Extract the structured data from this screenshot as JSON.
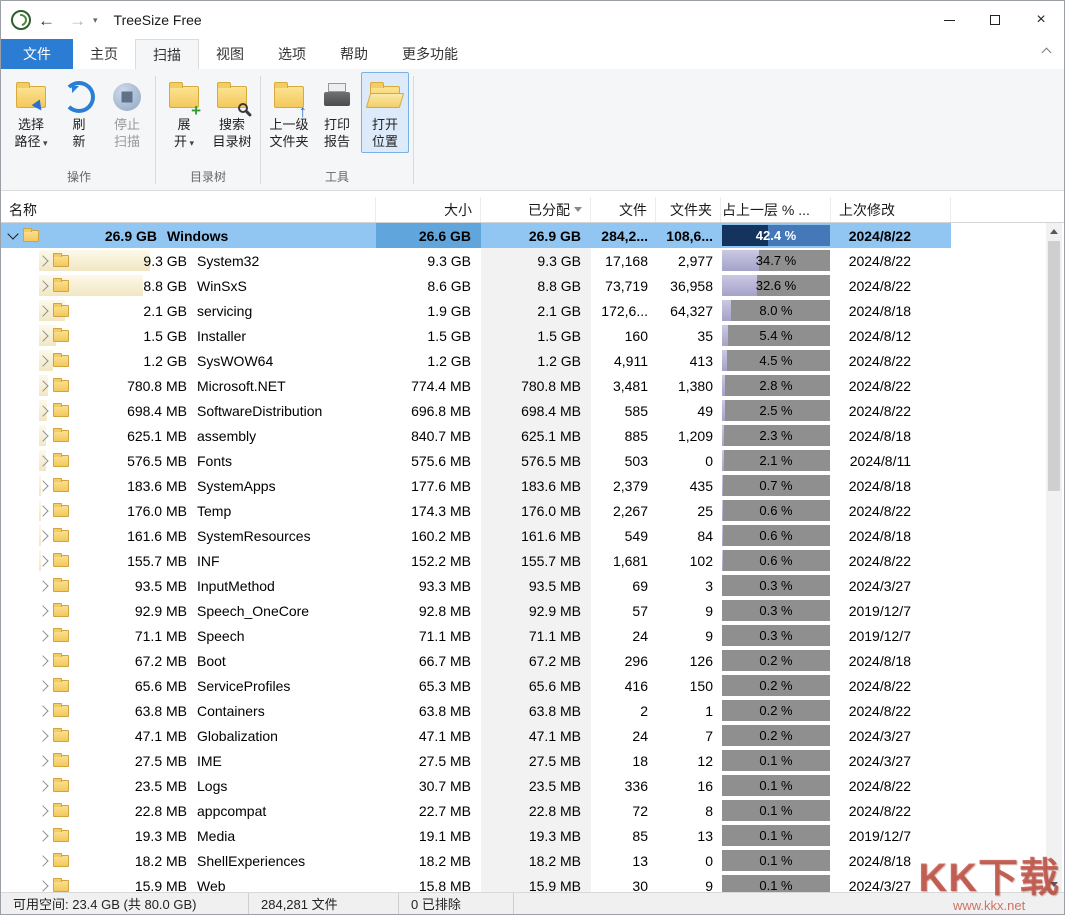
{
  "window": {
    "title": "TreeSize Free",
    "controls": {
      "close": "×"
    }
  },
  "nav": {
    "back": "←",
    "forward": "→"
  },
  "ribbon": {
    "tabs": [
      {
        "id": "file",
        "label": "文件",
        "type": "file"
      },
      {
        "id": "home",
        "label": "主页"
      },
      {
        "id": "scan",
        "label": "扫描",
        "active": true
      },
      {
        "id": "view",
        "label": "视图"
      },
      {
        "id": "options",
        "label": "选项"
      },
      {
        "id": "help",
        "label": "帮助"
      },
      {
        "id": "more-features",
        "label": "更多功能"
      }
    ],
    "groups": [
      {
        "label": "操作",
        "buttons": [
          {
            "id": "select-path",
            "lines": [
              "选择",
              "路径"
            ],
            "dropdown": true,
            "icon": "folder-cursor"
          },
          {
            "id": "refresh",
            "lines": [
              "刷",
              "新"
            ],
            "icon": "refresh"
          },
          {
            "id": "stop-scan",
            "lines": [
              "停止",
              "扫描"
            ],
            "icon": "stop",
            "disabled": true
          }
        ]
      },
      {
        "label": "目录树",
        "buttons": [
          {
            "id": "expand",
            "lines": [
              "展",
              "开"
            ],
            "dropdown": true,
            "icon": "folder-plus"
          },
          {
            "id": "search-tree",
            "lines": [
              "搜索",
              "目录树"
            ],
            "icon": "folder-search"
          }
        ]
      },
      {
        "label": "工具",
        "buttons": [
          {
            "id": "parent-folder",
            "lines": [
              "上一级",
              "文件夹"
            ],
            "icon": "folder-up"
          },
          {
            "id": "print-report",
            "lines": [
              "打印",
              "报告"
            ],
            "icon": "printer"
          },
          {
            "id": "open-location",
            "lines": [
              "打开",
              "位置"
            ],
            "icon": "folder-open",
            "highlighted": true
          }
        ]
      }
    ]
  },
  "table": {
    "columns": [
      {
        "label": "名称"
      },
      {
        "label": "大小"
      },
      {
        "label": "已分配",
        "sort": "desc"
      },
      {
        "label": "文件"
      },
      {
        "label": "文件夹"
      },
      {
        "label": "占上一层 % ..."
      },
      {
        "label": "上次修改"
      }
    ],
    "rows": [
      {
        "name": "Windows",
        "size_label": "26.9 GB",
        "size": "26.6 GB",
        "allocated": "26.9 GB",
        "files": "284,2...",
        "folders": "108,6...",
        "percent": "42.4 %",
        "percent_value": 42.4,
        "modified": "2024/8/22",
        "level": 0,
        "expanded": true,
        "selected": true
      },
      {
        "name": "System32",
        "size_label": "9.3 GB",
        "size": "9.3 GB",
        "allocated": "9.3 GB",
        "files": "17,168",
        "folders": "2,977",
        "percent": "34.7 %",
        "percent_value": 34.7,
        "modified": "2024/8/22",
        "level": 1
      },
      {
        "name": "WinSxS",
        "size_label": "8.8 GB",
        "size": "8.6 GB",
        "allocated": "8.8 GB",
        "files": "73,719",
        "folders": "36,958",
        "percent": "32.6 %",
        "percent_value": 32.6,
        "modified": "2024/8/22",
        "level": 1
      },
      {
        "name": "servicing",
        "size_label": "2.1 GB",
        "size": "1.9 GB",
        "allocated": "2.1 GB",
        "files": "172,6...",
        "folders": "64,327",
        "percent": "8.0 %",
        "percent_value": 8.0,
        "modified": "2024/8/18",
        "level": 1
      },
      {
        "name": "Installer",
        "size_label": "1.5 GB",
        "size": "1.5 GB",
        "allocated": "1.5 GB",
        "files": "160",
        "folders": "35",
        "percent": "5.4 %",
        "percent_value": 5.4,
        "modified": "2024/8/12",
        "level": 1
      },
      {
        "name": "SysWOW64",
        "size_label": "1.2 GB",
        "size": "1.2 GB",
        "allocated": "1.2 GB",
        "files": "4,911",
        "folders": "413",
        "percent": "4.5 %",
        "percent_value": 4.5,
        "modified": "2024/8/22",
        "level": 1
      },
      {
        "name": "Microsoft.NET",
        "size_label": "780.8 MB",
        "size": "774.4 MB",
        "allocated": "780.8 MB",
        "files": "3,481",
        "folders": "1,380",
        "percent": "2.8 %",
        "percent_value": 2.8,
        "modified": "2024/8/22",
        "level": 1
      },
      {
        "name": "SoftwareDistribution",
        "size_label": "698.4 MB",
        "size": "696.8 MB",
        "allocated": "698.4 MB",
        "files": "585",
        "folders": "49",
        "percent": "2.5 %",
        "percent_value": 2.5,
        "modified": "2024/8/22",
        "level": 1
      },
      {
        "name": "assembly",
        "size_label": "625.1 MB",
        "size": "840.7 MB",
        "allocated": "625.1 MB",
        "files": "885",
        "folders": "1,209",
        "percent": "2.3 %",
        "percent_value": 2.3,
        "modified": "2024/8/18",
        "level": 1
      },
      {
        "name": "Fonts",
        "size_label": "576.5 MB",
        "size": "575.6 MB",
        "allocated": "576.5 MB",
        "files": "503",
        "folders": "0",
        "percent": "2.1 %",
        "percent_value": 2.1,
        "modified": "2024/8/11",
        "level": 1
      },
      {
        "name": "SystemApps",
        "size_label": "183.6 MB",
        "size": "177.6 MB",
        "allocated": "183.6 MB",
        "files": "2,379",
        "folders": "435",
        "percent": "0.7 %",
        "percent_value": 0.7,
        "modified": "2024/8/18",
        "level": 1
      },
      {
        "name": "Temp",
        "size_label": "176.0 MB",
        "size": "174.3 MB",
        "allocated": "176.0 MB",
        "files": "2,267",
        "folders": "25",
        "percent": "0.6 %",
        "percent_value": 0.6,
        "modified": "2024/8/22",
        "level": 1
      },
      {
        "name": "SystemResources",
        "size_label": "161.6 MB",
        "size": "160.2 MB",
        "allocated": "161.6 MB",
        "files": "549",
        "folders": "84",
        "percent": "0.6 %",
        "percent_value": 0.6,
        "modified": "2024/8/18",
        "level": 1
      },
      {
        "name": "INF",
        "size_label": "155.7 MB",
        "size": "152.2 MB",
        "allocated": "155.7 MB",
        "files": "1,681",
        "folders": "102",
        "percent": "0.6 %",
        "percent_value": 0.6,
        "modified": "2024/8/22",
        "level": 1
      },
      {
        "name": "InputMethod",
        "size_label": "93.5 MB",
        "size": "93.3 MB",
        "allocated": "93.5 MB",
        "files": "69",
        "folders": "3",
        "percent": "0.3 %",
        "percent_value": 0.3,
        "modified": "2024/3/27",
        "level": 1
      },
      {
        "name": "Speech_OneCore",
        "size_label": "92.9 MB",
        "size": "92.8 MB",
        "allocated": "92.9 MB",
        "files": "57",
        "folders": "9",
        "percent": "0.3 %",
        "percent_value": 0.3,
        "modified": "2019/12/7",
        "level": 1
      },
      {
        "name": "Speech",
        "size_label": "71.1 MB",
        "size": "71.1 MB",
        "allocated": "71.1 MB",
        "files": "24",
        "folders": "9",
        "percent": "0.3 %",
        "percent_value": 0.3,
        "modified": "2019/12/7",
        "level": 1
      },
      {
        "name": "Boot",
        "size_label": "67.2 MB",
        "size": "66.7 MB",
        "allocated": "67.2 MB",
        "files": "296",
        "folders": "126",
        "percent": "0.2 %",
        "percent_value": 0.2,
        "modified": "2024/8/18",
        "level": 1
      },
      {
        "name": "ServiceProfiles",
        "size_label": "65.6 MB",
        "size": "65.3 MB",
        "allocated": "65.6 MB",
        "files": "416",
        "folders": "150",
        "percent": "0.2 %",
        "percent_value": 0.2,
        "modified": "2024/8/22",
        "level": 1
      },
      {
        "name": "Containers",
        "size_label": "63.8 MB",
        "size": "63.8 MB",
        "allocated": "63.8 MB",
        "files": "2",
        "folders": "1",
        "percent": "0.2 %",
        "percent_value": 0.2,
        "modified": "2024/8/22",
        "level": 1
      },
      {
        "name": "Globalization",
        "size_label": "47.1 MB",
        "size": "47.1 MB",
        "allocated": "47.1 MB",
        "files": "24",
        "folders": "7",
        "percent": "0.2 %",
        "percent_value": 0.2,
        "modified": "2024/3/27",
        "level": 1
      },
      {
        "name": "IME",
        "size_label": "27.5 MB",
        "size": "27.5 MB",
        "allocated": "27.5 MB",
        "files": "18",
        "folders": "12",
        "percent": "0.1 %",
        "percent_value": 0.1,
        "modified": "2024/3/27",
        "level": 1
      },
      {
        "name": "Logs",
        "size_label": "23.5 MB",
        "size": "30.7 MB",
        "allocated": "23.5 MB",
        "files": "336",
        "folders": "16",
        "percent": "0.1 %",
        "percent_value": 0.1,
        "modified": "2024/8/22",
        "level": 1
      },
      {
        "name": "appcompat",
        "size_label": "22.8 MB",
        "size": "22.7 MB",
        "allocated": "22.8 MB",
        "files": "72",
        "folders": "8",
        "percent": "0.1 %",
        "percent_value": 0.1,
        "modified": "2024/8/22",
        "level": 1
      },
      {
        "name": "Media",
        "size_label": "19.3 MB",
        "size": "19.1 MB",
        "allocated": "19.3 MB",
        "files": "85",
        "folders": "13",
        "percent": "0.1 %",
        "percent_value": 0.1,
        "modified": "2019/12/7",
        "level": 1
      },
      {
        "name": "ShellExperiences",
        "size_label": "18.2 MB",
        "size": "18.2 MB",
        "allocated": "18.2 MB",
        "files": "13",
        "folders": "0",
        "percent": "0.1 %",
        "percent_value": 0.1,
        "modified": "2024/8/18",
        "level": 1
      },
      {
        "name": "Web",
        "size_label": "15.9 MB",
        "size": "15.8 MB",
        "allocated": "15.9 MB",
        "files": "30",
        "folders": "9",
        "percent": "0.1 %",
        "percent_value": 0.1,
        "modified": "2024/3/27",
        "level": 1
      }
    ]
  },
  "statusbar": {
    "items": [
      "可用空间: 23.4 GB (共 80.0 GB)",
      "284,281 文件",
      "0 已排除"
    ]
  },
  "watermark": {
    "title": "KK下载",
    "url": "www.kkx.net"
  }
}
